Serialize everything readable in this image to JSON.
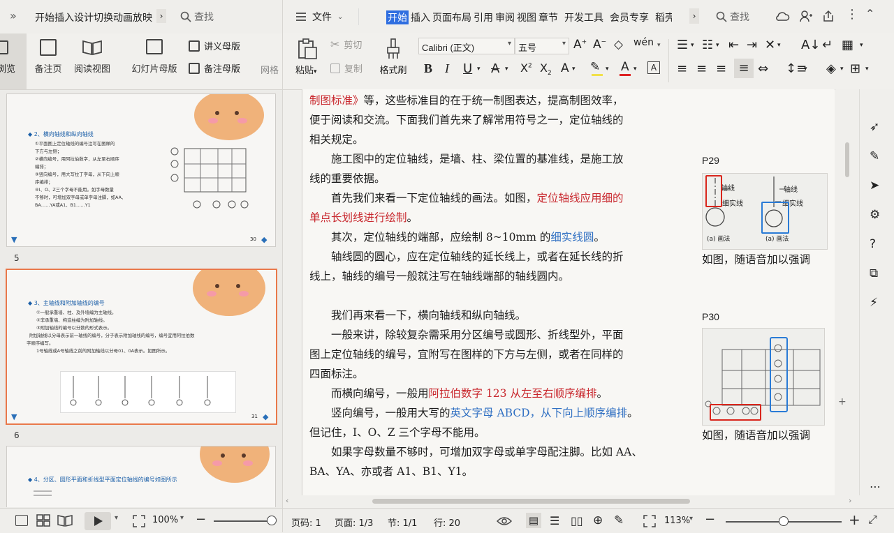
{
  "left_window": {
    "tab_title": "开始插入设计切换动画放映",
    "search_placeholder": "查找",
    "ribbon": {
      "normal_view": "浏览",
      "notes_page": "备注页",
      "reading_view": "阅读视图",
      "slide_master": "幻灯片母版",
      "handout_master": "讲义母版",
      "notes_master": "备注母版",
      "grid": "网格"
    },
    "slides": [
      {
        "number": "5",
        "title": "◆ 2、横向轴线和纵向轴线",
        "lines": [
          "①平面图上定位轴线的编号注写在图样的",
          "下方与左侧；",
          "②横向编号，用阿拉伯数字，从左至右顺序",
          "编排；",
          "③竖向编号，用大写拉丁字母，从下向上顺",
          "序编排；",
          "④I、O、Z三个字母不能用。如字母数量",
          "不够时，可增加双字母或单字母注脚，如AA、",
          "BA……YA或A1、B1……Y1"
        ],
        "page": "30"
      },
      {
        "number": "6",
        "title": "◆ 3、主轴线和附加轴线的编号",
        "lines": [
          "①一般承重墙、柱、及外墙编为主轴线。",
          "②非承重墙、构造柱编为附加轴线。",
          "③附加轴线的编号以分数的形式表示。",
          "附加轴线以分母表示前一轴线的编号，分子表示附加轴线的编号，编号宜用阿拉伯数",
          "字顺序编写。",
          "1号轴线或A号轴线之前的附加轴线以分母01、0A表示。如图所示。"
        ],
        "page": "31"
      },
      {
        "number": "",
        "title": "◆ 4、分区、圆形平面和折线型平面定位轴线的编号如图所示",
        "lines": [],
        "page": ""
      }
    ],
    "status": {
      "zoom": "100%"
    }
  },
  "right_window": {
    "file_menu": "文件",
    "menu_tabs": [
      "开始",
      "插入",
      "页面布局",
      "引用",
      "审阅",
      "视图",
      "章节",
      "开发工具",
      "会员专享",
      "稻壳"
    ],
    "active_tab": "开始",
    "search_placeholder": "查找",
    "toolbar": {
      "paste": "粘贴",
      "cut": "剪切",
      "copy": "复制",
      "format_painter": "格式刷",
      "font_name": "Calibri (正文)",
      "font_size": "五号"
    },
    "document": {
      "paragraphs": [
        [
          {
            "t": "制图标准》",
            "c": "red"
          },
          {
            "t": "等，这些标准目的在于统一制图表达，提高制图效率，"
          }
        ],
        [
          {
            "t": "便于阅读和交流。下面我们首先来了解常用符号之一，定位轴线的"
          }
        ],
        [
          {
            "t": "相关规定。"
          }
        ],
        [
          {
            "t": "　　施工图中的定位轴线，是墙、柱、梁位置的基准线，是施工放"
          }
        ],
        [
          {
            "t": "线的重要依据。"
          }
        ],
        [
          {
            "t": "　　首先我们来看一下定位轴线的画法。如图，"
          },
          {
            "t": "定位轴线应用细的",
            "c": "red"
          }
        ],
        [
          {
            "t": "单点长划线进行绘制",
            "c": "red"
          },
          {
            "t": "。"
          }
        ],
        [
          {
            "t": "　　其次，定位轴线的端部，应绘制 8~10mm 的"
          },
          {
            "t": "细实线圆",
            "c": "blue"
          },
          {
            "t": "。"
          }
        ],
        [
          {
            "t": "　　轴线圆的圆心，应在定位轴线的延长线上，或者在延长线的折"
          }
        ],
        [
          {
            "t": "线上，轴线的编号一般就注写在轴线端部的轴线圆内。"
          }
        ],
        [
          {
            "t": ""
          }
        ],
        [
          {
            "t": "　　我们再来看一下，横向轴线和纵向轴线。"
          }
        ],
        [
          {
            "t": "　　一般来讲，除较复杂需采用分区编号或圆形、折线型外，平面"
          }
        ],
        [
          {
            "t": "图上定位轴线的编号，宜附写在图样的下方与左侧，或者在同样的"
          }
        ],
        [
          {
            "t": "四面标注。"
          }
        ],
        [
          {
            "t": "　　而横向编号，一般用"
          },
          {
            "t": "阿拉伯数字 123 从左至右顺序编排",
            "c": "red"
          },
          {
            "t": "。"
          }
        ],
        [
          {
            "t": "　　竖向编号，一般用大写的"
          },
          {
            "t": "英文字母 ABCD，从下向上顺序编排",
            "c": "blue"
          },
          {
            "t": "。"
          }
        ],
        [
          {
            "t": "但记住，I、O、Z 三个字母不能用。"
          }
        ],
        [
          {
            "t": "　　如果字母数量不够时，可增加双字母或单字母配注脚。比如 AA、"
          }
        ],
        [
          {
            "t": "BA、YA、亦或者 A1、B1、Y1。"
          }
        ]
      ]
    },
    "notes": {
      "p29_label": "P29",
      "p29_fig_axis": "轴线",
      "p29_fig_thin": "细实线",
      "p29_fig_caption_a": "(a) 画法",
      "p29_fig_caption_b": "(a) 画法",
      "p29_text": "如图，随语音加以强调",
      "p30_label": "P30",
      "p30_text": "如图，随语音加以强调"
    },
    "status": {
      "page_num": "页码: 1",
      "page_total": "页面: 1/3",
      "section": "节: 1/1",
      "row": "行: 20",
      "zoom": "113%"
    }
  },
  "colors": {
    "accent_blue": "#2f6ee0",
    "red_text": "#c8262c",
    "blue_text": "#2f6fc2",
    "selected_slide_border": "#e9784a",
    "highlight_red_box": "#d9261c",
    "highlight_blue_box": "#2a7bd6"
  }
}
